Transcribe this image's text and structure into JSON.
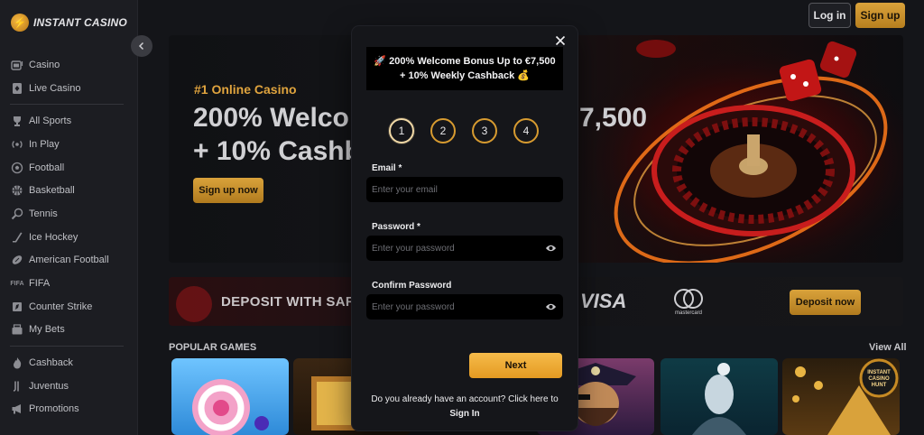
{
  "brand": {
    "name": "INSTANT CASINO",
    "logo_glyph": "⚡"
  },
  "header": {
    "login_label": "Log in",
    "signup_label": "Sign up"
  },
  "sidebar": {
    "group1": [
      {
        "label": "Casino",
        "icon": "slot-machine-icon"
      },
      {
        "label": "Live Casino",
        "icon": "live-cards-icon"
      }
    ],
    "group2": [
      {
        "label": "All Sports",
        "icon": "trophy-icon"
      },
      {
        "label": "In Play",
        "icon": "broadcast-icon"
      },
      {
        "label": "Football",
        "icon": "soccer-ball-icon"
      },
      {
        "label": "Basketball",
        "icon": "basketball-icon"
      },
      {
        "label": "Tennis",
        "icon": "tennis-racket-icon"
      },
      {
        "label": "Ice Hockey",
        "icon": "hockey-stick-icon"
      },
      {
        "label": "American Football",
        "icon": "american-football-icon"
      },
      {
        "label": "FIFA",
        "icon": "fifa-icon"
      },
      {
        "label": "Counter Strike",
        "icon": "counter-strike-icon"
      },
      {
        "label": "My Bets",
        "icon": "bets-icon"
      }
    ],
    "group3": [
      {
        "label": "Cashback",
        "icon": "flame-icon"
      },
      {
        "label": "Juventus",
        "icon": "juventus-icon"
      },
      {
        "label": "Promotions",
        "icon": "megaphone-icon"
      }
    ]
  },
  "hero": {
    "kicker": "#1 Online Casino",
    "headline_line1": "200% Welco",
    "headline_right": "7,500",
    "headline_line2": "+ 10% Cashb",
    "cta": "Sign up now"
  },
  "deposit_banner": {
    "text": "DEPOSIT WITH SAF",
    "visa": "VISA",
    "mastercard": "mastercard",
    "cta": "Deposit now"
  },
  "games": {
    "title": "POPULAR GAMES",
    "view_all": "View All",
    "hunt_label": "INSTANT CASINO HUNT"
  },
  "modal": {
    "promo_line1": "🚀 200% Welcome Bonus Up to €7,500",
    "promo_line2": "+ 10% Weekly Cashback 💰",
    "steps": [
      "1",
      "2",
      "3",
      "4"
    ],
    "active_step": 1,
    "email_label": "Email *",
    "email_placeholder": "Enter your email",
    "password_label": "Password *",
    "password_placeholder": "Enter your password",
    "confirm_label": "Confirm Password",
    "confirm_placeholder": "Enter your password",
    "next_label": "Next",
    "have_account": "Do you already have an account? Click here to",
    "sign_in": "Sign In"
  },
  "colors": {
    "accent": "#d9a23b",
    "background": "#141519",
    "modal": "#15161a"
  }
}
